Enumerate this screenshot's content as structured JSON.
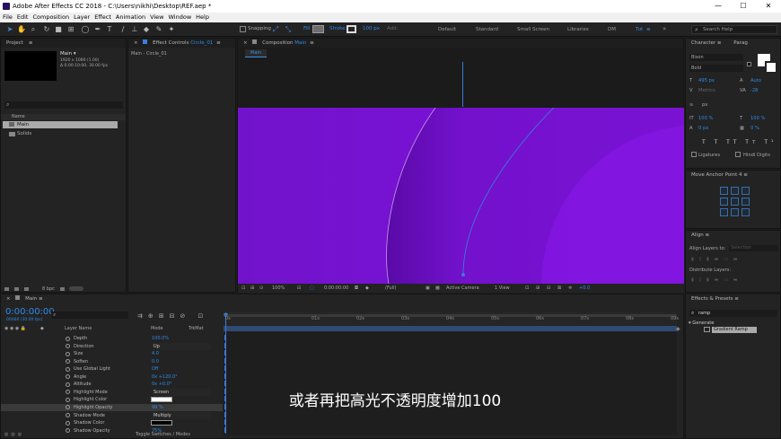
{
  "window": {
    "title": "Adobe After Effects CC 2018 - C:\\Users\\nikhi\\Desktop\\REF.aep *",
    "min": "—",
    "max": "☐",
    "close": "✕"
  },
  "menu": [
    "File",
    "Edit",
    "Composition",
    "Layer",
    "Effect",
    "Animation",
    "View",
    "Window",
    "Help"
  ],
  "toolbar": {
    "snapping": "Snapping",
    "fill": "Fill",
    "stroke": "Stroke",
    "stroke_px": "100 px",
    "add": "Add:",
    "workspaces": [
      "Default",
      "Standard",
      "Small Screen",
      "Libraries",
      "DM",
      "Tut"
    ],
    "search_placeholder": "Search Help"
  },
  "project": {
    "title": "Project",
    "comp_name": "Main ▾",
    "comp_size": "1920 x 1080 (1.00)",
    "comp_duration": "Δ 0:00:10:00, 30.00 fps",
    "col_name": "Name",
    "items": [
      "Main",
      "Solids"
    ],
    "bpc": "8 bpc"
  },
  "effect_controls": {
    "title": "Effect Controls",
    "layer": "Circle_01",
    "path": "Main - Circle_01"
  },
  "composition": {
    "title": "Composition",
    "comp": "Main",
    "tab": "Main",
    "zoom": "100%",
    "time": "0:00:00:00",
    "quality": "(Full)",
    "camera": "Active Camera",
    "views": "1 View",
    "exposure": "+0.0",
    "bg_color": "#7a12d4"
  },
  "character": {
    "tab1": "Character",
    "tab2": "Parag",
    "font": "Bison",
    "style": "Bold",
    "size": "495 px",
    "leading": "Auto",
    "kerning": "Metrics",
    "tracking": "-28",
    "stroke_width": "px",
    "vscale": "100 %",
    "hscale": "100 %",
    "baseline": "0 px",
    "tsume": "0 %",
    "ligatures": "Ligatures",
    "hindi": "Hindi Digits"
  },
  "anchor": {
    "title": "Move Anchor Point 4"
  },
  "align": {
    "title": "Align",
    "align_to": "Align Layers to:",
    "selection": "Selection",
    "distribute": "Distribute Layers:"
  },
  "effects": {
    "title": "Effects & Presets",
    "search": "ramp",
    "group": "Generate",
    "item": "Gradient Ramp"
  },
  "timeline": {
    "tab": "Main",
    "timecode": "0:00:00:00",
    "fps": "00000 (30.00 fps)",
    "col_layer": "Layer Name",
    "col_mode": "Mode",
    "col_trkmat": "TrkMat",
    "ticks": [
      "0s",
      "01s",
      "02s",
      "03s",
      "04s",
      "05s",
      "06s",
      "07s",
      "08s",
      "09s",
      "10s"
    ],
    "props": [
      {
        "name": "Depth",
        "value": "100.0%"
      },
      {
        "name": "Direction",
        "value": "Up"
      },
      {
        "name": "Size",
        "value": "4.0"
      },
      {
        "name": "Soften",
        "value": "0.0"
      },
      {
        "name": "Use Global Light",
        "value": "Off"
      },
      {
        "name": "Angle",
        "value": "0x +120.0°"
      },
      {
        "name": "Altitude",
        "value": "0x +0.0°"
      },
      {
        "name": "Highlight Mode",
        "value": "Screen"
      },
      {
        "name": "Highlight Color",
        "value": ""
      },
      {
        "name": "Highlight Opacity",
        "value": "99 %"
      },
      {
        "name": "Shadow Mode",
        "value": "Multiply"
      },
      {
        "name": "Shadow Color",
        "value": ""
      },
      {
        "name": "Shadow Opacity",
        "value": "75%"
      }
    ],
    "toggle": "Toggle Switches / Modes"
  },
  "subtitle": "或者再把高光不透明度增加100"
}
